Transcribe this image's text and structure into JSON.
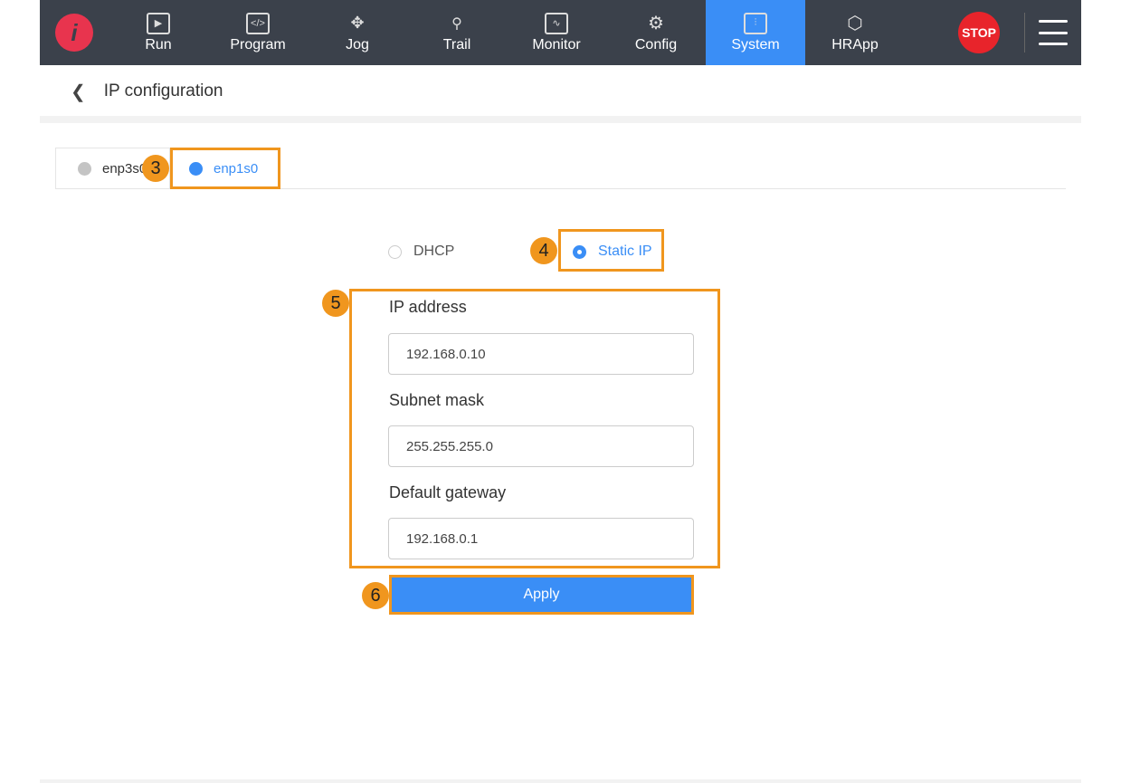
{
  "nav": {
    "items": [
      {
        "label": "Run",
        "icon": "play-icon"
      },
      {
        "label": "Program",
        "icon": "code-icon"
      },
      {
        "label": "Jog",
        "icon": "move-icon"
      },
      {
        "label": "Trail",
        "icon": "location-icon"
      },
      {
        "label": "Monitor",
        "icon": "monitor-icon"
      },
      {
        "label": "Config",
        "icon": "gear-icon"
      },
      {
        "label": "System",
        "icon": "system-icon",
        "active": true
      },
      {
        "label": "HRApp",
        "icon": "cube-icon"
      }
    ],
    "stop": "STOP"
  },
  "header": {
    "title": "IP configuration"
  },
  "tabs": [
    {
      "label": "enp3s0"
    },
    {
      "label": "enp1s0",
      "active": true
    }
  ],
  "mode": {
    "dhcp": "DHCP",
    "static": "Static IP",
    "selected": "Static IP"
  },
  "form": {
    "ip_label": "IP address",
    "ip_value": "192.168.0.10",
    "mask_label": "Subnet mask",
    "mask_value": "255.255.255.0",
    "gw_label": "Default gateway",
    "gw_value": "192.168.0.1",
    "apply": "Apply"
  },
  "badges": [
    "3",
    "4",
    "5",
    "6"
  ],
  "colors": {
    "accent": "#3a8ef6",
    "highlight": "#f0961e",
    "topbar": "#3b414b",
    "stop": "#e8242b"
  }
}
